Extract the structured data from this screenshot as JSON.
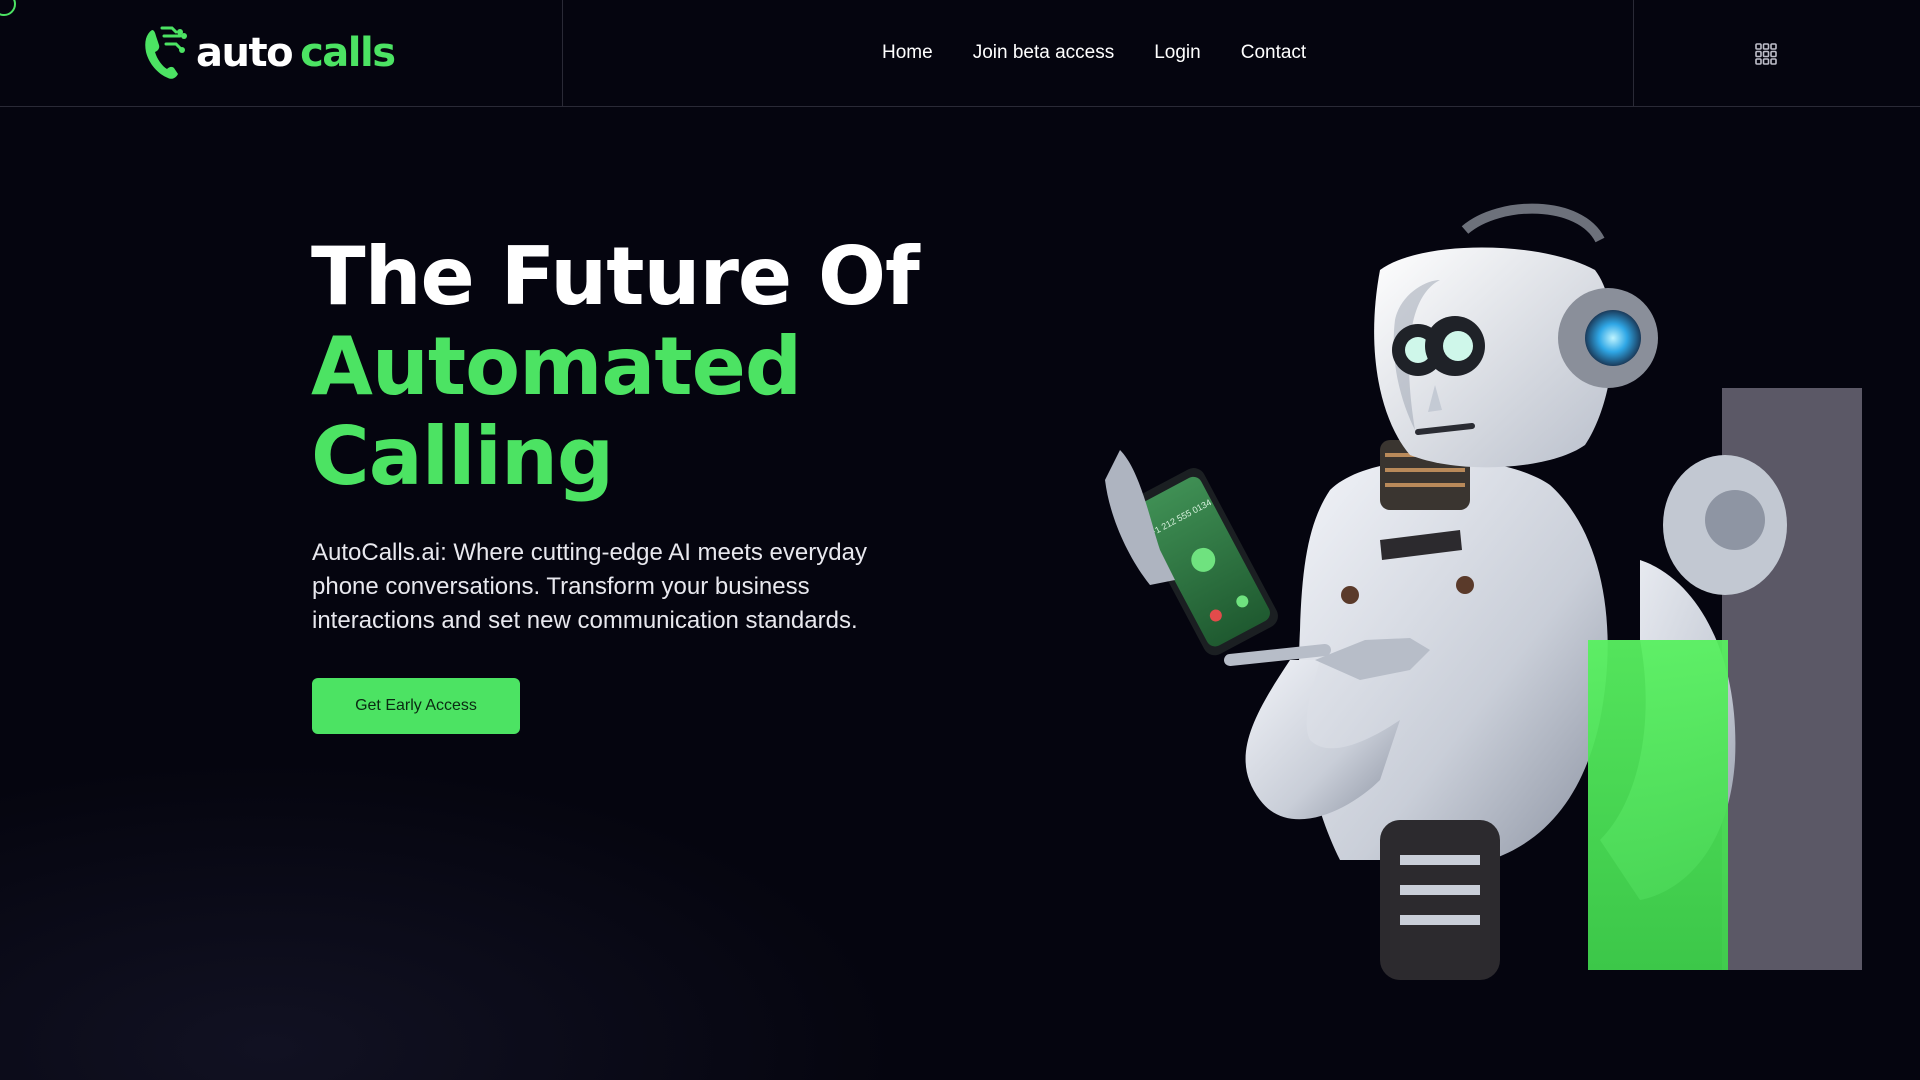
{
  "logo": {
    "part1": "auto",
    "part2": "calls"
  },
  "nav": {
    "items": [
      {
        "label": "Home"
      },
      {
        "label": "Join beta access"
      },
      {
        "label": "Login"
      },
      {
        "label": "Contact"
      }
    ],
    "menu_icon": "grid-menu-icon"
  },
  "hero": {
    "title_line1": "The Future Of",
    "title_line2": "Automated",
    "title_line3": "Calling",
    "description": "AutoCalls.ai: Where cutting-edge AI meets everyday phone conversations. Transform your business interactions and set new communication standards.",
    "cta_label": "Get Early Access"
  },
  "illustration": {
    "subject": "robot-with-phone",
    "phone_number": "+1 212 555 0134"
  },
  "colors": {
    "background": "#05050f",
    "accent_green": "#4ce363",
    "gray_bar": "#5b5866",
    "text": "#ffffff"
  }
}
